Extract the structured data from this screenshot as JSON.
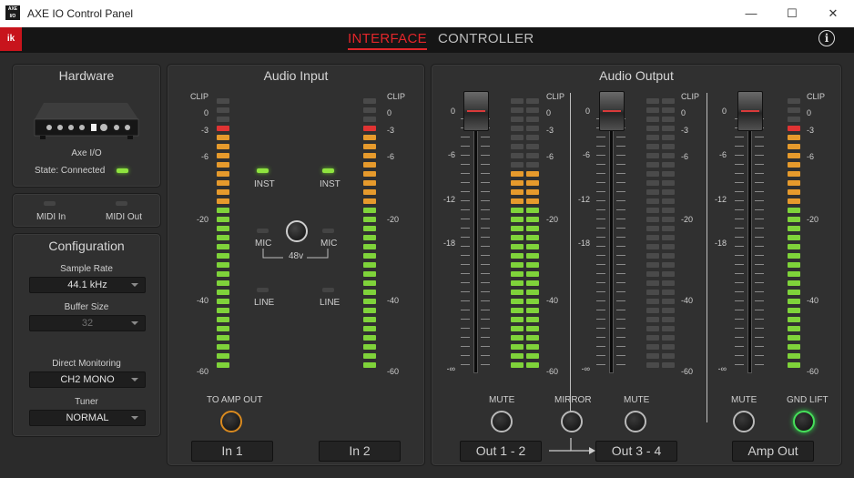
{
  "window": {
    "title": "AXE IO Control Panel",
    "icon_text": "AXE I/O"
  },
  "tabs": {
    "interface": "INTERFACE",
    "controller": "CONTROLLER"
  },
  "icons": {
    "brand": "ik-logo",
    "info": "info-icon",
    "minimize": "minimize-icon",
    "maximize": "maximize-icon",
    "close": "close-icon"
  },
  "colors": {
    "accent": "#e2262a",
    "led_on": "#8fe33f",
    "meter_green": "#7fd33a",
    "meter_amber": "#e69a2c",
    "meter_red": "#e03333"
  },
  "hardware": {
    "title": "Hardware",
    "device": "Axe I/O",
    "state": "State: Connected"
  },
  "midi": {
    "in": "MIDI In",
    "out": "MIDI Out"
  },
  "configuration": {
    "title": "Configuration",
    "sample_rate_label": "Sample Rate",
    "sample_rate": "44.1 kHz",
    "buffer_label": "Buffer Size",
    "buffer": "32",
    "direct_label": "Direct Monitoring",
    "direct": "CH2 MONO",
    "tuner_label": "Tuner",
    "tuner": "NORMAL"
  },
  "audio_input": {
    "title": "Audio Input",
    "inst": "INST",
    "mic": "MIC",
    "phantom": "48v",
    "line": "LINE",
    "to_amp_out": "TO AMP OUT",
    "in1": "In 1",
    "in2": "In 2"
  },
  "meter_labels": [
    "CLIP",
    "0",
    "-3",
    "-6",
    "-20",
    "-40",
    "-60"
  ],
  "fader_labels": [
    "0",
    "-6",
    "-12",
    "-18",
    "-∞"
  ],
  "audio_output": {
    "title": "Audio Output",
    "mute": "MUTE",
    "mirror": "MIRROR",
    "gnd_lift": "GND LIFT",
    "out12": "Out 1 - 2",
    "out34": "Out 3 - 4",
    "amp_out": "Amp Out"
  },
  "meters": {
    "in1": {
      "level": "-3",
      "clip": true
    },
    "in2": {
      "level": "-3",
      "clip": true
    },
    "out12_left": {
      "level": "-6",
      "clip": false
    },
    "out12_right": {
      "level": "-6",
      "clip": false
    },
    "out34": {
      "level": "-∞",
      "clip": false
    },
    "amp_out": {
      "level": "-3",
      "clip": true
    }
  },
  "faders": {
    "out12": "0",
    "out34": "0",
    "amp_out": "0"
  }
}
